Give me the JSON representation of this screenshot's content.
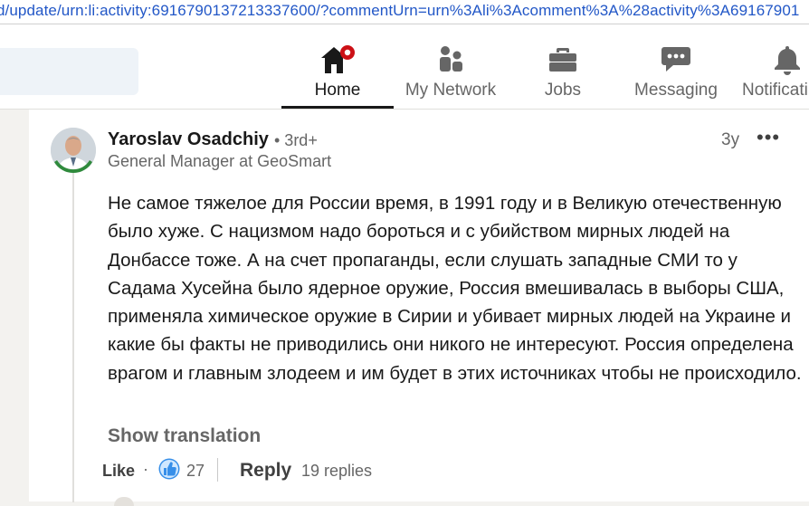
{
  "browser": {
    "url": "d/update/urn:li:activity:6916790137213337600/?commentUrn=urn%3Ali%3Acomment%3A%28activity%3A69167901"
  },
  "nav": {
    "items": [
      {
        "label": "Home",
        "icon": "home-icon",
        "active": true
      },
      {
        "label": "My Network",
        "icon": "network-icon"
      },
      {
        "label": "Jobs",
        "icon": "briefcase-icon"
      },
      {
        "label": "Messaging",
        "icon": "messaging-icon"
      },
      {
        "label": "Notificati",
        "icon": "bell-icon"
      }
    ],
    "home_badge_color": "#cc1016"
  },
  "comment": {
    "author": "Yaroslav Osadchiy",
    "degree": "• 3rd+",
    "headline": "General Manager at GeoSmart",
    "timestamp": "3y",
    "more_label": "•••",
    "text": "Не самое тяжелое для России время, в 1991 году и в Великую отечественную было хуже. С нацизмом надо бороться и с убийством мирных людей на Донбассе тоже. А на счет пропаганды, если слушать западные СМИ то у Садама Хусейна было ядерное оружие, Россия вмешивалась в выборы США, применяла химическое оружие в Сирии и убивает мирных людей на Украине и какие бы факты не приводились они никого не интересуют. Россия определена врагом и главным злодеем и им будет в этих источниках чтобы не происходило.",
    "show_translation": "Show translation",
    "actions": {
      "like_label": "Like",
      "separator": "·",
      "like_count": "27",
      "reply_label": "Reply",
      "replies": "19 replies"
    }
  },
  "colors": {
    "link_blue": "#2257c7",
    "like_blue": "#378fe9",
    "text_dark": "#191919",
    "text_muted": "#666666"
  }
}
